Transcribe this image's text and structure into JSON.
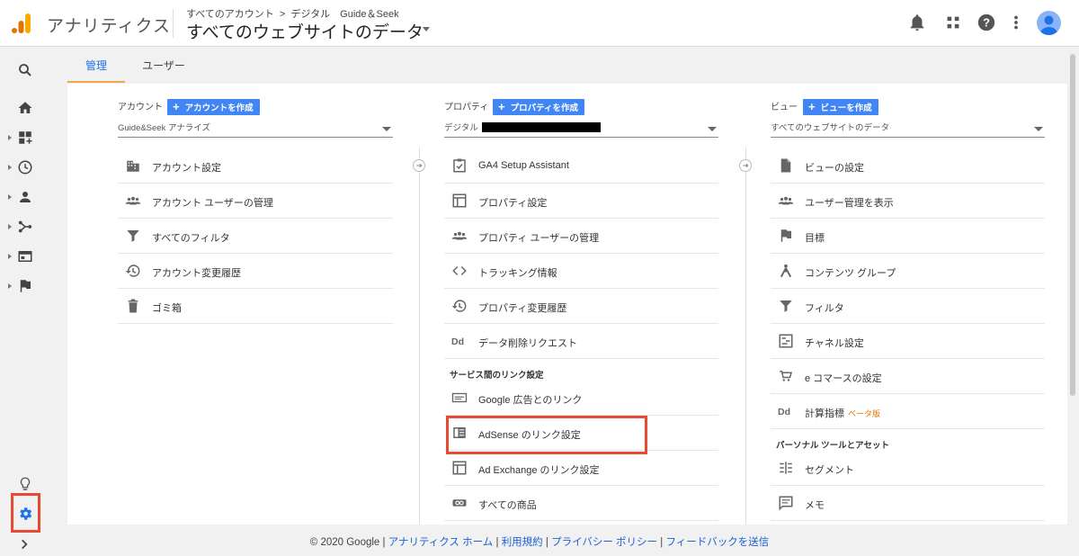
{
  "header": {
    "app_name": "アナリティクス",
    "breadcrumb": [
      "すべてのアカウント",
      "デジタル　Guide＆Seek"
    ],
    "breadcrumb_sep": ">",
    "view_title": "すべてのウェブサイトのデータ"
  },
  "tabs": [
    {
      "label": "管理"
    },
    {
      "label": "ユーザー"
    }
  ],
  "account": {
    "heading": "アカウント",
    "create_label": "アカウントを作成",
    "selected": "Guide&Seek アナライズ",
    "items": [
      {
        "label": "アカウント設定",
        "icon": "building-icon"
      },
      {
        "label": "アカウント ユーザーの管理",
        "icon": "people-icon"
      },
      {
        "label": "すべてのフィルタ",
        "icon": "filter-icon"
      },
      {
        "label": "アカウント変更履歴",
        "icon": "history-icon"
      },
      {
        "label": "ゴミ箱",
        "icon": "trash-icon"
      }
    ]
  },
  "property": {
    "heading": "プロパティ",
    "create_label": "プロパティを作成",
    "selected": "デジタル",
    "items": [
      {
        "label": "GA4 Setup Assistant",
        "icon": "checklist-icon"
      },
      {
        "label": "プロパティ設定",
        "icon": "layout-icon"
      },
      {
        "label": "プロパティ ユーザーの管理",
        "icon": "people-icon"
      },
      {
        "label": "トラッキング情報",
        "icon": "code-icon"
      },
      {
        "label": "プロパティ変更履歴",
        "icon": "history-icon"
      },
      {
        "label": "データ削除リクエスト",
        "icon": "dd-icon"
      }
    ],
    "link_section": "サービス間のリンク設定",
    "link_items": [
      {
        "label": "Google 広告とのリンク",
        "icon": "ads-icon"
      },
      {
        "label": "AdSense のリンク設定",
        "icon": "adsense-icon"
      },
      {
        "label": "Ad Exchange のリンク設定",
        "icon": "layout-icon"
      },
      {
        "label": "すべての商品",
        "icon": "link-icon"
      }
    ]
  },
  "view": {
    "heading": "ビュー",
    "create_label": "ビューを作成",
    "selected": "すべてのウェブサイトのデータ",
    "items": [
      {
        "label": "ビューの設定",
        "icon": "doc-icon"
      },
      {
        "label": "ユーザー管理を表示",
        "icon": "people-icon"
      },
      {
        "label": "目標",
        "icon": "flag-icon"
      },
      {
        "label": "コンテンツ グループ",
        "icon": "content-group-icon"
      },
      {
        "label": "フィルタ",
        "icon": "filter-icon"
      },
      {
        "label": "チャネル設定",
        "icon": "channel-icon"
      },
      {
        "label": "e コマースの設定",
        "icon": "cart-icon"
      },
      {
        "label": "計算指標",
        "icon": "dd-icon",
        "badge": "ベータ版"
      }
    ],
    "personal_section": "パーソナル ツールとアセット",
    "personal_items": [
      {
        "label": "セグメント",
        "icon": "segment-icon"
      },
      {
        "label": "メモ",
        "icon": "note-icon"
      }
    ]
  },
  "footer": {
    "copyright": "© 2020 Google",
    "links": [
      "アナリティクス ホーム",
      "利用規約",
      "プライバシー ポリシー",
      "フィードバックを送信"
    ]
  },
  "colors": {
    "accent": "#1a73e8",
    "button": "#4285f4",
    "highlight": "#e64a33",
    "tab_underline": "#f0a74b"
  }
}
